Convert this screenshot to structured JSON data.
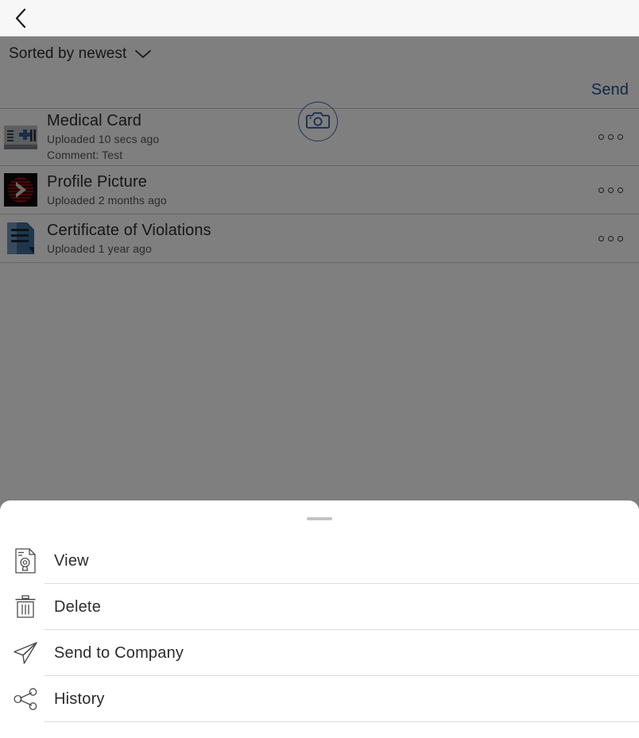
{
  "navbar": {
    "back_icon": "chevron-left-icon"
  },
  "toolbar": {
    "sort_label": "Sorted by newest",
    "sort_chevron_icon": "chevron-down-icon",
    "send_label": "Send",
    "camera_icon": "camera-icon"
  },
  "documents": [
    {
      "title": "Medical Card",
      "uploaded": "Uploaded 10 secs ago",
      "comment": "Comment: Test",
      "thumb_icon": "medical-card-thumbnail",
      "overflow_icon": "more-options-icon"
    },
    {
      "title": "Profile Picture",
      "uploaded": "Uploaded 2 months ago",
      "comment": "",
      "thumb_icon": "profile-picture-thumbnail",
      "overflow_icon": "more-options-icon"
    },
    {
      "title": "Certificate of Violations",
      "uploaded": "Uploaded 1 year ago",
      "comment": "",
      "thumb_icon": "document-thumbnail",
      "overflow_icon": "more-options-icon"
    }
  ],
  "sheet": {
    "grabber": "drag-handle",
    "items": [
      {
        "label": "View",
        "icon": "document-view-icon"
      },
      {
        "label": "Delete",
        "icon": "trash-icon"
      },
      {
        "label": "Send to Company",
        "icon": "paper-plane-icon"
      },
      {
        "label": "History",
        "icon": "share-network-icon"
      }
    ]
  },
  "colors": {
    "accent_blue": "#1f4e89",
    "text_primary": "#2c2c2e",
    "text_secondary": "#55555a",
    "scrim": "#808080",
    "divider": "#c9c9c9",
    "navbar_bg": "#f7f7f7",
    "sheet_bg": "#ffffff",
    "logo_red": "#8c1010"
  }
}
